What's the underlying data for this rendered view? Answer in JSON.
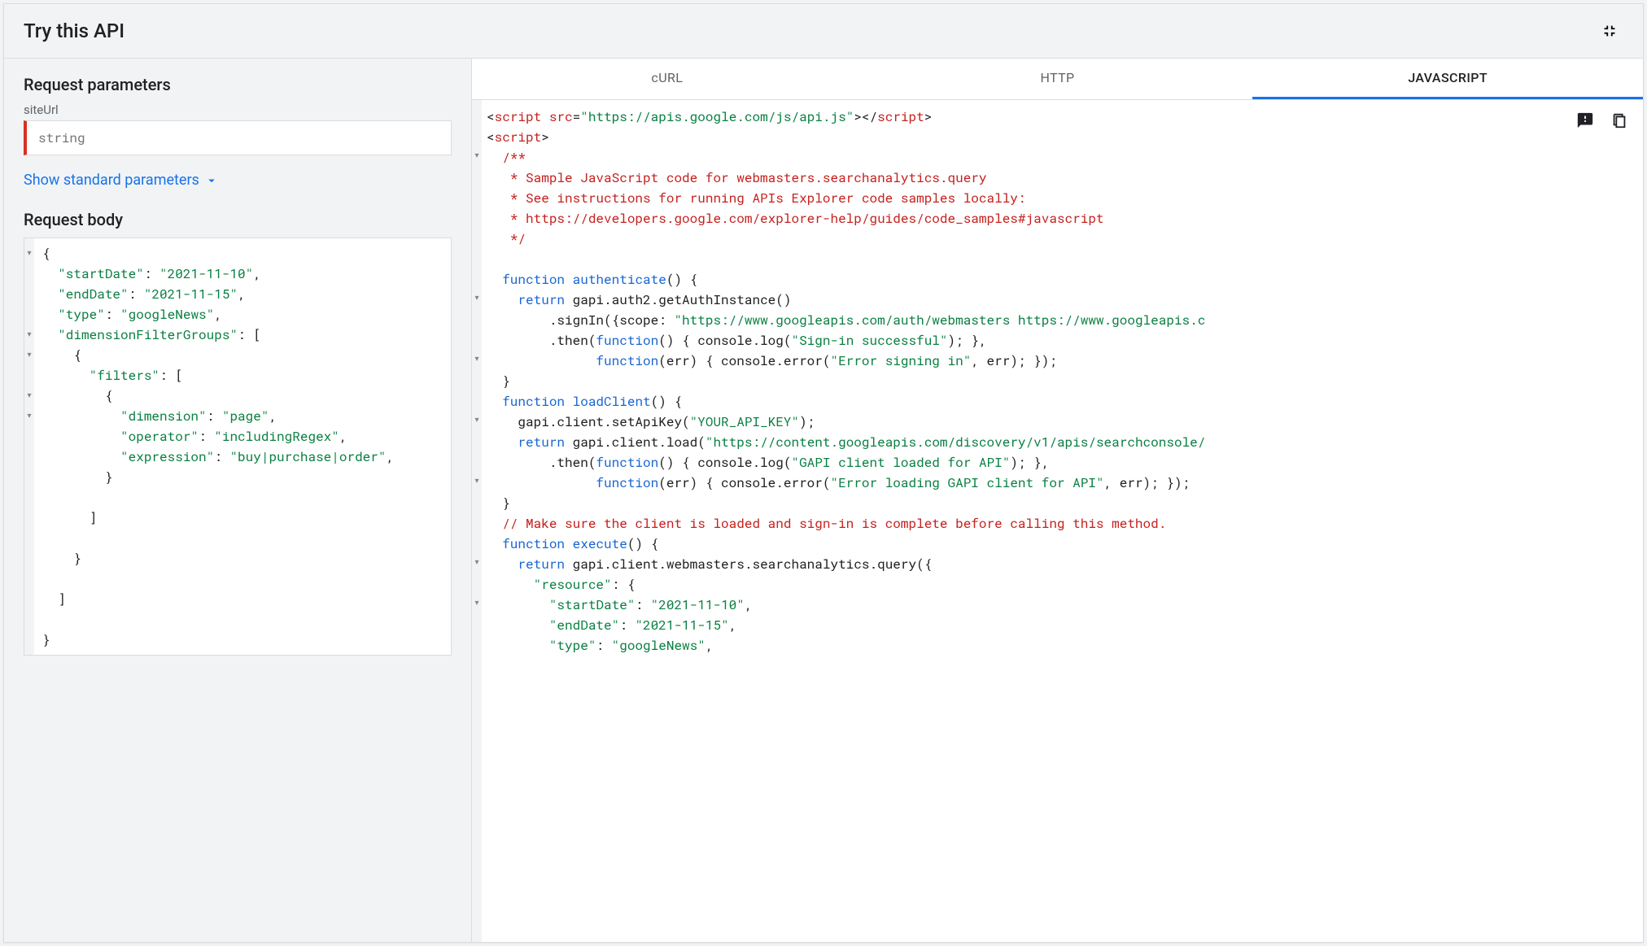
{
  "header": {
    "title": "Try this API"
  },
  "left": {
    "section_params": "Request parameters",
    "param_siteurl_label": "siteUrl",
    "param_siteurl_placeholder": "string",
    "show_standard": "Show standard parameters",
    "section_body": "Request body",
    "request_body": {
      "startDate": "2021-11-10",
      "endDate": "2021-11-15",
      "type": "googleNews",
      "dimensionFilterGroups": [
        {
          "filters": [
            {
              "dimension": "page",
              "operator": "includingRegex",
              "expression": "buy|purchase|order"
            }
          ]
        }
      ]
    }
  },
  "tabs": {
    "curl": "cURL",
    "http": "HTTP",
    "javascript": "JAVASCRIPT",
    "active": "javascript"
  },
  "code": {
    "script_src": "https://apis.google.com/js/api.js",
    "comment_1": "/**",
    "comment_2": " * Sample JavaScript code for webmasters.searchanalytics.query",
    "comment_3": " * See instructions for running APIs Explorer code samples locally:",
    "comment_4": " * https://developers.google.com/explorer-help/guides/code_samples#javascript",
    "comment_5": " */",
    "fn_auth": "authenticate",
    "auth_scope": "https://www.googleapis.com/auth/webmasters https://www.googleapis.c",
    "msg_signin_ok": "Sign-in successful",
    "msg_signin_err": "Error signing in",
    "fn_load": "loadClient",
    "api_key": "YOUR_API_KEY",
    "discovery": "https://content.googleapis.com/discovery/v1/apis/searchconsole/",
    "msg_load_ok": "GAPI client loaded for API",
    "msg_load_err": "Error loading GAPI client for API",
    "comment_exec": "// Make sure the client is loaded and sign-in is complete before calling this method.",
    "fn_exec": "execute",
    "res_startDate": "2021-11-10",
    "res_endDate": "2021-11-15",
    "res_type": "googleNews"
  }
}
